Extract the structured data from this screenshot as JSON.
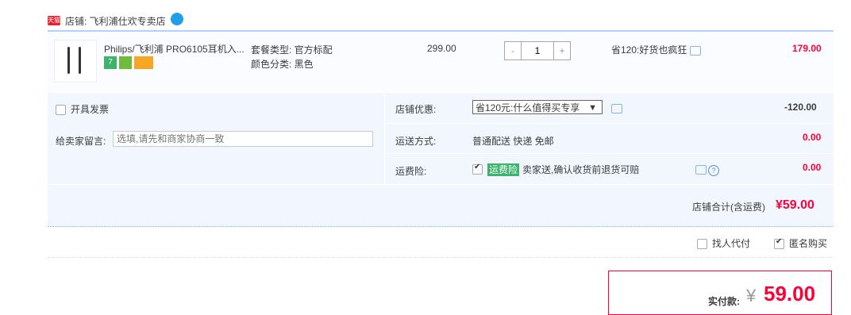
{
  "shop": {
    "badge": "天猫",
    "name": "店铺: 飞利浦仕欢专卖店"
  },
  "item": {
    "title": "Philips/飞利浦 PRO6105耳机入...",
    "sku_type": "套餐类型: 官方标配",
    "sku_color": "颜色分类: 黑色",
    "price": "299.00",
    "quantity": "1",
    "qty_minus": "-",
    "qty_plus": "+",
    "promo": "省120:好货也疯狂",
    "subtotal": "179.00",
    "badges": [
      "7",
      "",
      ""
    ]
  },
  "options": {
    "invoice": "开具发票",
    "message_label": "给卖家留言:",
    "message_placeholder": "选填,请先和商家协商一致",
    "discount_label": "店铺优惠:",
    "discount_selected": "省120元:什么值得买专享",
    "discount_arrow": "▼",
    "discount_value": "-120.00",
    "shipping_label": "运送方式:",
    "shipping_value": "普通配送 快递 免邮",
    "shipping_price": "0.00",
    "insurance_label": "运费险:",
    "insurance_tag": "运费险",
    "insurance_desc": "卖家送,确认收货前退货可赔",
    "insurance_price": "0.00",
    "help": "?"
  },
  "totals": {
    "shop_total_label": "店铺合计(含运费)",
    "shop_total": "¥59.00",
    "find_payer": "找人代付",
    "anonymous": "匿名购买",
    "pay_label": "实付款:",
    "pay_currency": "¥",
    "pay_amount": "59.00"
  }
}
